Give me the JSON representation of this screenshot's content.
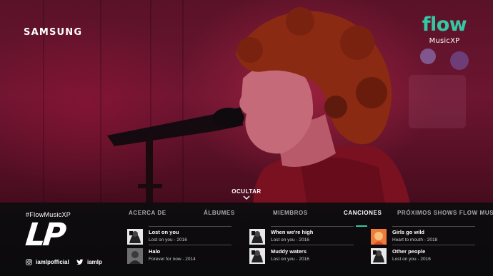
{
  "brand": {
    "tv_brand": "SAMSUNG",
    "app_word": "flow",
    "app_sub": "MusicXP",
    "accent_color": "#35c7a3"
  },
  "player": {
    "hide_label": "OCULTAR"
  },
  "artist": {
    "hashtag": "#FlowMusicXP",
    "mark": "LP",
    "instagram": "iamlpofficial",
    "twitter": "iamlp"
  },
  "tabs": [
    {
      "label": "ACERCA DE",
      "active": false
    },
    {
      "label": "ÁLBUMES",
      "active": false
    },
    {
      "label": "MIEMBROS",
      "active": false
    },
    {
      "label": "CANCIONES",
      "active": true
    },
    {
      "label": "PRÓXIMOS SHOWS FLOW MUSIC X",
      "active": false
    }
  ],
  "songs": [
    {
      "title": "Lost on you",
      "meta": "Lost on you - 2016",
      "thumb_icon": "album-bw-icon"
    },
    {
      "title": "Halo",
      "meta": "Forever for now - 2014",
      "thumb_icon": "album-gray-icon"
    },
    {
      "title": "When we're high",
      "meta": "Lost on you - 2016",
      "thumb_icon": "album-bw-icon"
    },
    {
      "title": "Muddy waters",
      "meta": "Lost on you - 2016",
      "thumb_icon": "album-bw-icon"
    },
    {
      "title": "Girls go wild",
      "meta": "Heart to mouth - 2018",
      "thumb_icon": "album-orange-icon"
    },
    {
      "title": "Other people",
      "meta": "Lost on you - 2016",
      "thumb_icon": "album-bw-icon"
    }
  ]
}
